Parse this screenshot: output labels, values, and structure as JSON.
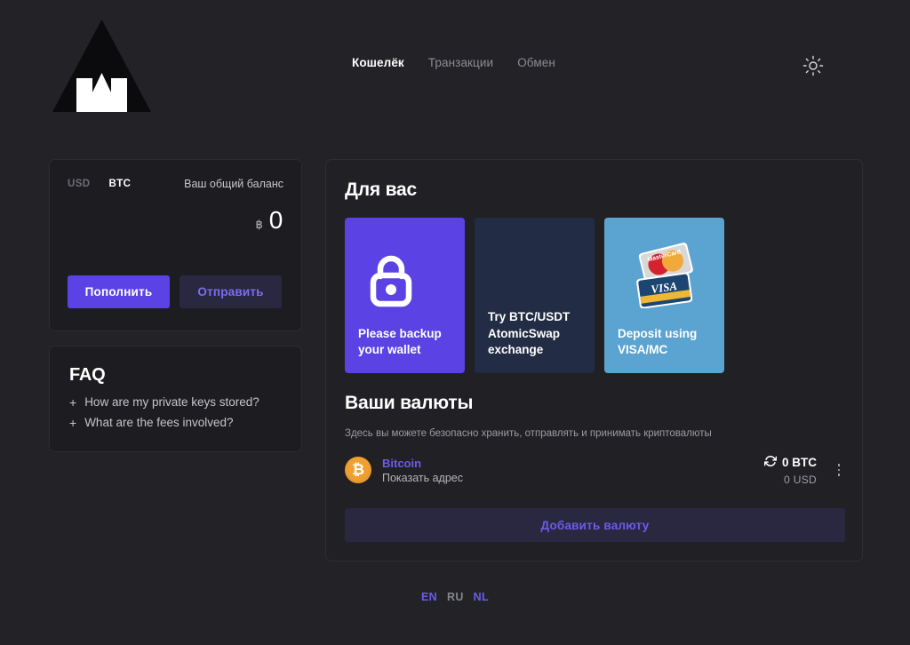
{
  "header": {
    "logo_alt": "wallet-logo",
    "nav": [
      {
        "label": "Кошелёк",
        "active": true
      },
      {
        "label": "Транзакции",
        "active": false
      },
      {
        "label": "Обмен",
        "active": false
      }
    ],
    "theme_toggle_icon": "sun-icon"
  },
  "balance": {
    "currency_usd": "USD",
    "currency_btc": "BTC",
    "total_label": "Ваш общий баланс",
    "symbol": "฿",
    "value": "0",
    "deposit_button": "Пополнить",
    "send_button": "Отправить"
  },
  "faq": {
    "title": "FAQ",
    "items": [
      {
        "plus": "+",
        "label": "How are my private keys stored?"
      },
      {
        "plus": "+",
        "label": "What are the fees involved?"
      }
    ]
  },
  "for_you": {
    "title": "Для вас",
    "cards": [
      {
        "text": "Please backup\nyour wallet",
        "icon": "lock-icon",
        "color": "#5b42e4"
      },
      {
        "text": "Try BTC/USDT\nAtomicSwap\nexchange",
        "icon": "none",
        "color": "#222c44"
      },
      {
        "text": "Deposit using\nVISA/MC",
        "icon": "credit-cards-icon",
        "color": "#5ba3d0"
      }
    ]
  },
  "currencies": {
    "title": "Ваши валюты",
    "subtitle": "Здесь вы можете безопасно хранить, отправлять и принимать криптовалюты",
    "rows": [
      {
        "symbol": "₿",
        "name": "Bitcoin",
        "action": "Показать адрес",
        "amount": "0 BTC",
        "fiat": "0  USD",
        "refresh_icon": "refresh-icon",
        "menu_icon": "kebab-menu-icon"
      }
    ],
    "add_button": "Добавить валюту"
  },
  "footer": {
    "languages": [
      {
        "label": "EN",
        "current": false
      },
      {
        "label": "RU",
        "current": true
      },
      {
        "label": "NL",
        "current": false
      }
    ]
  },
  "colors": {
    "page_bg": "#232327",
    "card_bg": "#1d1d21",
    "panel_bg": "#212125",
    "accent_purple": "#5b42e4",
    "muted_purple": "#2a2740",
    "link_purple": "#6d5bea",
    "bitcoin_orange": "#f0a030",
    "navy_card": "#222c44",
    "blue_card": "#5ba3d0"
  }
}
